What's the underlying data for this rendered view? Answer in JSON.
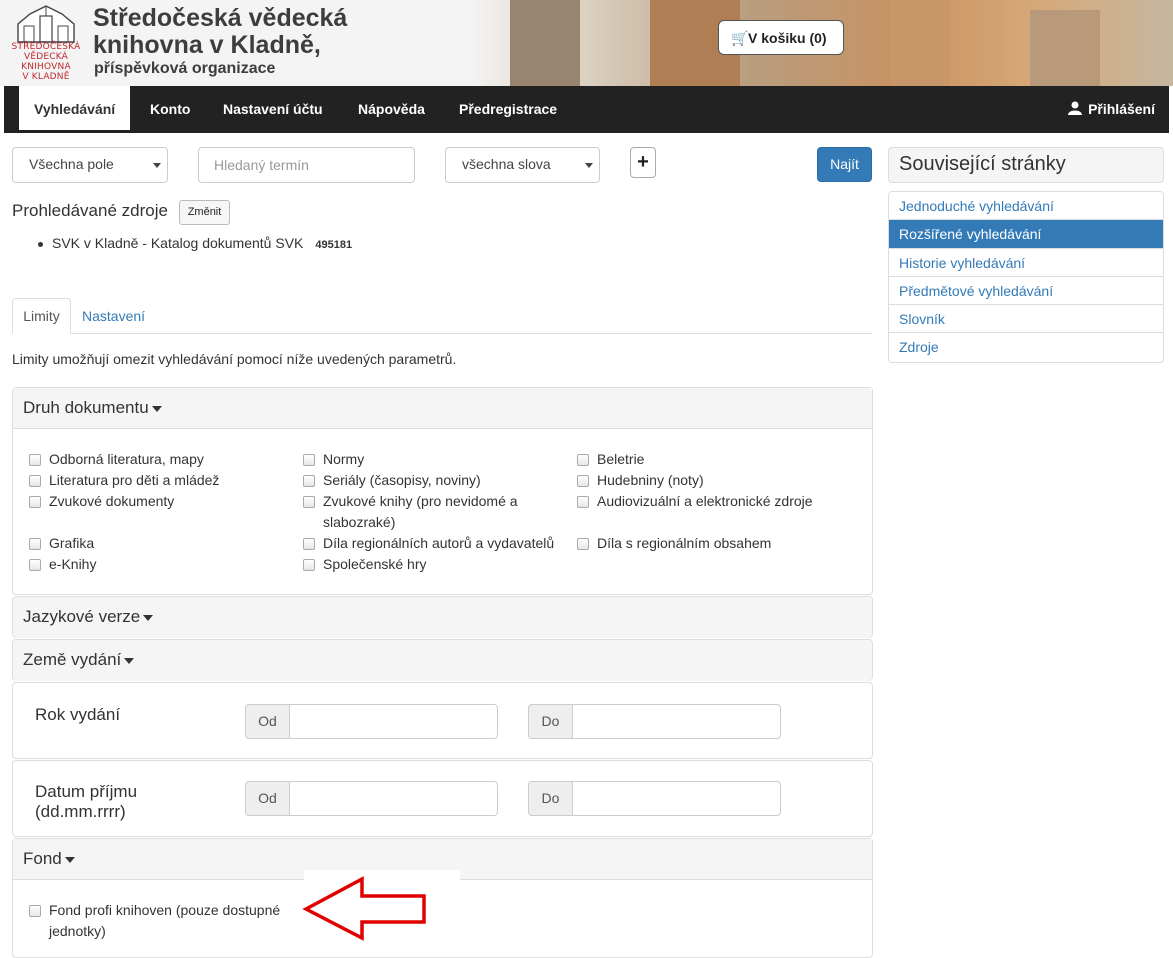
{
  "header": {
    "logo_lines": [
      "STŘEDOČESKÁ",
      "VĚDECKÁ",
      "KNIHOVNA",
      "V KLADNĚ"
    ],
    "title_line1": "Středočeská vědecká",
    "title_line2": "knihovna v Kladně,",
    "subtitle": "příspěvková organizace",
    "cart_label": "V košiku (0)"
  },
  "nav": {
    "items": [
      "Vyhledávání",
      "Konto",
      "Nastavení účtu",
      "Nápověda",
      "Předregistrace"
    ],
    "active": "Vyhledávání",
    "login_label": "Přihlášení"
  },
  "search": {
    "field_select": "Všechna pole",
    "term_placeholder": "Hledaný termín",
    "mode_select": "všechna slova",
    "add_label": "+",
    "find_label": "Najít"
  },
  "sources": {
    "title": "Prohledávané zdroje",
    "change_label": "Změnit",
    "item_label": "SVK v Kladně - Katalog dokumentů SVK",
    "item_count": "495181"
  },
  "tabs": [
    "Limity",
    "Nastavení"
  ],
  "limits_desc": "Limity umožňují omezit vyhledávání pomocí níže uvedených parametrů.",
  "panels": {
    "doc_type": {
      "title": "Druh dokumentu",
      "options": [
        "Odborná literatura, mapy",
        "Normy",
        "Beletrie",
        "Literatura pro děti a mládež",
        "Seriály (časopisy, noviny)",
        "Hudebniny (noty)",
        "Zvukové dokumenty",
        "Zvukové knihy (pro nevidomé a slabozraké)",
        "Audiovizuální a elektronické zdroje",
        "Grafika",
        "Díla regionálních autorů a vydavatelů",
        "Díla s regionálním obsahem",
        "e-Knihy",
        "Společenské hry"
      ]
    },
    "language": {
      "title": "Jazykové verze"
    },
    "country": {
      "title": "Země vydání"
    },
    "year": {
      "label": "Rok vydání",
      "from": "Od",
      "to": "Do"
    },
    "received": {
      "label_line1": "Datum příjmu",
      "label_line2": "(dd.mm.rrrr)",
      "from": "Od",
      "to": "Do"
    },
    "fond": {
      "title": "Fond",
      "options": [
        "Fond profi knihoven (pouze dostupné jednotky)"
      ]
    }
  },
  "sidebar": {
    "title": "Související stránky",
    "items": [
      "Jednoduché vyhledávání",
      "Rozšířené vyhledávání",
      "Historie vyhledávání",
      "Předmětové vyhledávání",
      "Slovník",
      "Zdroje"
    ],
    "active": "Rozšířené vyhledávání"
  },
  "colors": {
    "nav_bg": "#222222",
    "primary": "#337ab7",
    "arrow": "#e00000",
    "logo_red": "#c1272d"
  }
}
